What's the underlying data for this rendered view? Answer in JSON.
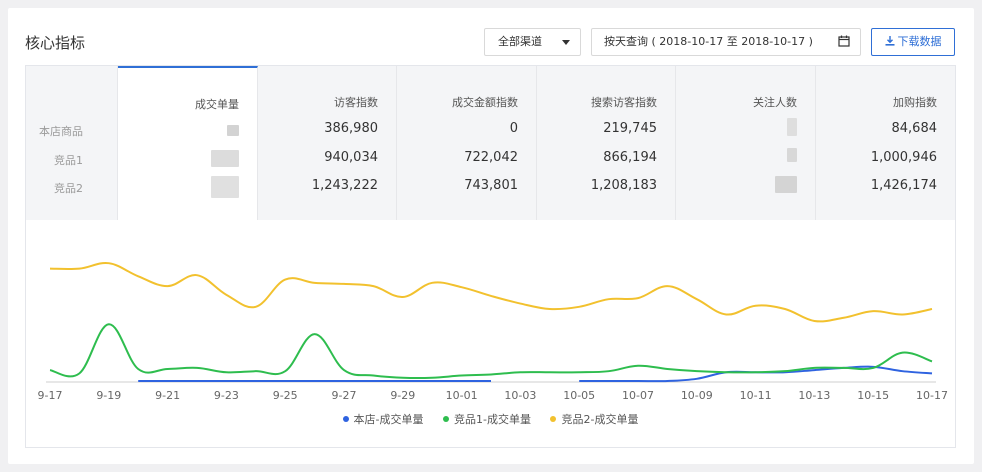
{
  "header": {
    "title": "核心指标",
    "channel_select": "全部渠道",
    "date_range": "按天查询 ( 2018-10-17 至 2018-10-17 )",
    "download_label": "下载数据"
  },
  "table": {
    "row_labels": [
      "本店商品",
      "竞品1",
      "竞品2"
    ],
    "columns": [
      {
        "header": "成交单量",
        "cells": [
          "",
          "",
          ""
        ]
      },
      {
        "header": "访客指数",
        "cells": [
          "386,980",
          "940,034",
          "1,243,222"
        ]
      },
      {
        "header": "成交金额指数",
        "cells": [
          "0",
          "722,042",
          "743,801"
        ]
      },
      {
        "header": "搜索访客指数",
        "cells": [
          "219,745",
          "866,194",
          "1,208,183"
        ]
      },
      {
        "header": "关注人数",
        "cells": [
          "",
          "",
          ""
        ]
      },
      {
        "header": "加购指数",
        "cells": [
          "84,684",
          "1,000,946",
          "1,426,174"
        ]
      }
    ]
  },
  "colors": {
    "accent": "#2f6fd6",
    "series_store": "#2f63e0",
    "series_comp1": "#2ebd4e",
    "series_comp2": "#f2c12e"
  },
  "chart_data": {
    "type": "line",
    "x": [
      "9-17",
      "9-18",
      "9-19",
      "9-20",
      "9-21",
      "9-22",
      "9-23",
      "9-24",
      "9-25",
      "9-26",
      "9-27",
      "9-28",
      "9-29",
      "9-30",
      "10-01",
      "10-02",
      "10-03",
      "10-04",
      "10-05",
      "10-06",
      "10-07",
      "10-08",
      "10-09",
      "10-10",
      "10-11",
      "10-12",
      "10-13",
      "10-14",
      "10-15",
      "10-16",
      "10-17"
    ],
    "tick_labels": [
      "9-17",
      "9-19",
      "9-21",
      "9-23",
      "9-25",
      "9-27",
      "9-29",
      "10-01",
      "10-03",
      "10-05",
      "10-07",
      "10-09",
      "10-11",
      "10-13",
      "10-15",
      "10-17"
    ],
    "ylim": [
      0,
      110
    ],
    "grid": false,
    "legend": "bottom-center",
    "series": [
      {
        "name": "本店-成交单量",
        "values": [
          null,
          null,
          null,
          0,
          0,
          0,
          0,
          0,
          0,
          0,
          0,
          0,
          0,
          0,
          0,
          0,
          null,
          null,
          0,
          0,
          0,
          0,
          2,
          8,
          8,
          8,
          10,
          12,
          13,
          9,
          7
        ]
      },
      {
        "name": "竞品1-成交单量",
        "values": [
          10,
          7,
          52,
          11,
          11,
          12,
          8,
          9,
          9,
          43,
          10,
          5,
          3,
          3,
          5,
          6,
          8,
          8,
          8,
          9,
          14,
          11,
          9,
          8,
          8,
          9,
          12,
          12,
          12,
          26,
          18
        ]
      },
      {
        "name": "竞品2-成交单量",
        "values": [
          103,
          103,
          108,
          96,
          87,
          97,
          79,
          68,
          93,
          90,
          89,
          87,
          77,
          90,
          86,
          78,
          71,
          66,
          68,
          75,
          76,
          87,
          75,
          61,
          69,
          66,
          55,
          58,
          64,
          61,
          66
        ]
      }
    ]
  }
}
